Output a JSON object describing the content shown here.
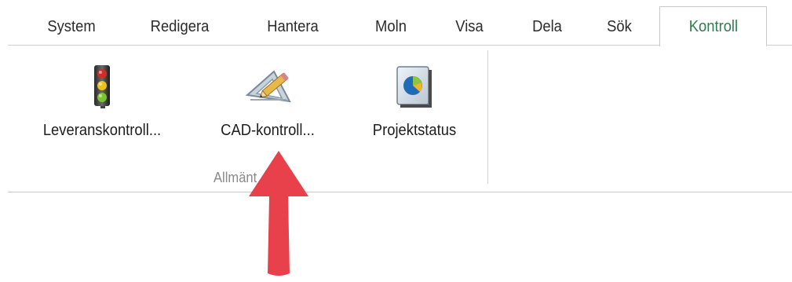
{
  "tabs": [
    {
      "label": "System"
    },
    {
      "label": "Redigera"
    },
    {
      "label": "Hantera"
    },
    {
      "label": "Moln"
    },
    {
      "label": "Visa"
    },
    {
      "label": "Dela"
    },
    {
      "label": "Sök"
    },
    {
      "label": "Kontroll",
      "active": true
    }
  ],
  "ribbon": {
    "buttons": [
      {
        "label": "Leveranskontroll...",
        "icon": "traffic-light-icon"
      },
      {
        "label": "CAD-kontroll...",
        "icon": "cad-drafting-icon"
      },
      {
        "label": "Projektstatus",
        "icon": "pie-chart-icon"
      }
    ],
    "group_label": "Allmänt"
  },
  "colors": {
    "active_tab_text": "#2f7d4f",
    "annotation_arrow": "#e8414b"
  }
}
